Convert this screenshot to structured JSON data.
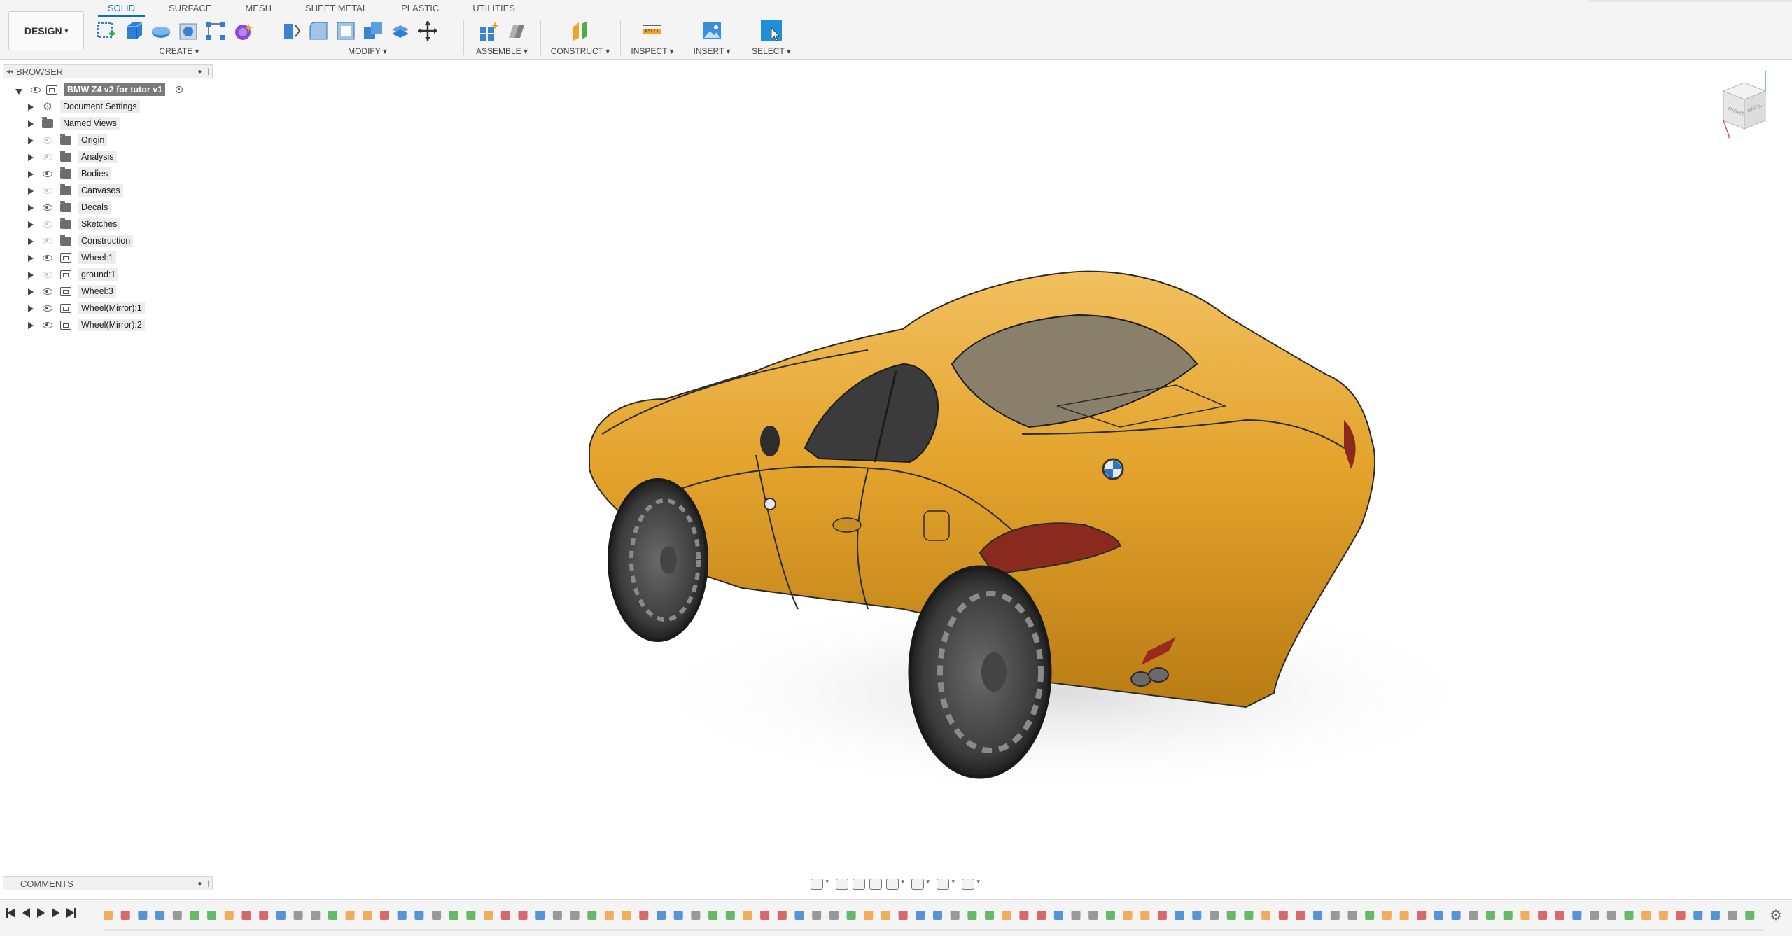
{
  "toolbar": {
    "workspace_label": "DESIGN",
    "tabs": [
      "SOLID",
      "SURFACE",
      "MESH",
      "SHEET METAL",
      "PLASTIC",
      "UTILITIES"
    ],
    "active_tab": "SOLID",
    "groups": {
      "create": "CREATE",
      "modify": "MODIFY",
      "assemble": "ASSEMBLE",
      "construct": "CONSTRUCT",
      "inspect": "INSPECT",
      "insert": "INSERT",
      "select": "SELECT"
    },
    "accent_color": "#0f6fc6"
  },
  "browser": {
    "title": "BROWSER",
    "root": "BMW Z4 v2 for tutor v1",
    "items": [
      {
        "label": "Document Settings",
        "icon": "gear-icon"
      },
      {
        "label": "Named Views",
        "icon": "folder-icon"
      },
      {
        "label": "Origin",
        "icon": "folder-icon",
        "visible": false
      },
      {
        "label": "Analysis",
        "icon": "folder-icon",
        "visible": false
      },
      {
        "label": "Bodies",
        "icon": "folder-icon",
        "visible": true
      },
      {
        "label": "Canvases",
        "icon": "folder-icon",
        "visible": false
      },
      {
        "label": "Decals",
        "icon": "folder-icon",
        "visible": true
      },
      {
        "label": "Sketches",
        "icon": "folder-icon",
        "visible": false
      },
      {
        "label": "Construction",
        "icon": "folder-icon",
        "visible": false
      },
      {
        "label": "Wheel:1",
        "icon": "component-icon",
        "visible": true
      },
      {
        "label": "ground:1",
        "icon": "component-icon",
        "visible": false
      },
      {
        "label": "Wheel:3",
        "icon": "component-icon",
        "visible": true
      },
      {
        "label": "Wheel(Mirror):1",
        "icon": "component-icon",
        "visible": true
      },
      {
        "label": "Wheel(Mirror):2",
        "icon": "component-icon",
        "visible": true
      }
    ]
  },
  "viewcube": {
    "face_right": "RIGHT",
    "face_back": "BACK"
  },
  "comments": {
    "title": "COMMENTS"
  },
  "model": {
    "body_color": "#e3a32c"
  }
}
